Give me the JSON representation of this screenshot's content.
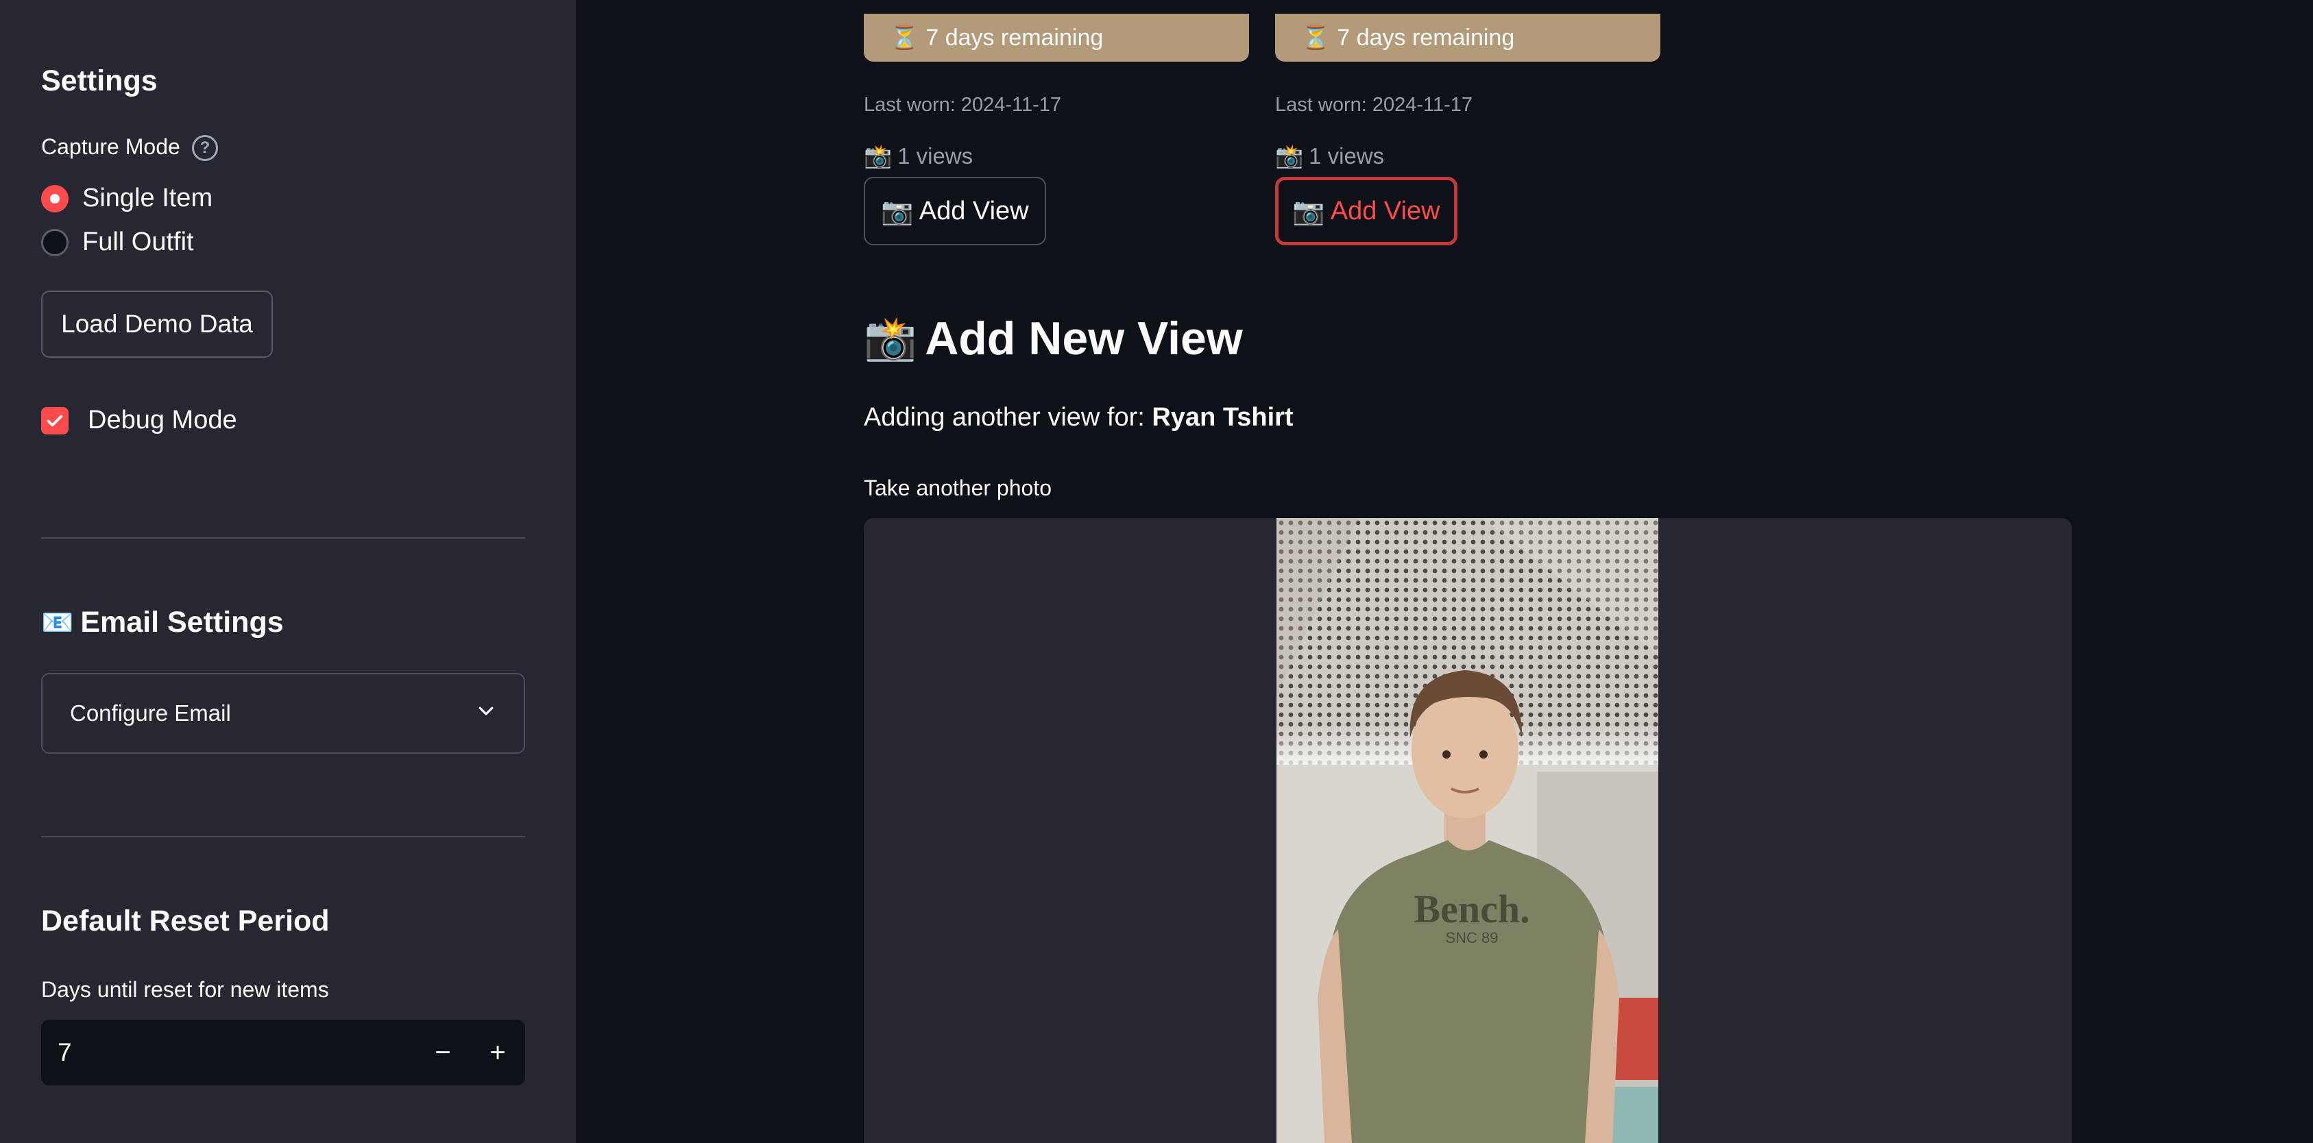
{
  "sidebar": {
    "settings_title": "Settings",
    "capture_mode": {
      "label": "Capture Mode",
      "options": [
        "Single Item",
        "Full Outfit"
      ],
      "selected": "Single Item"
    },
    "load_demo_label": "Load Demo Data",
    "debug_mode": {
      "label": "Debug Mode",
      "checked": true
    },
    "email_settings_title": "Email Settings",
    "email_settings_icon": "📧",
    "configure_email_label": "Configure Email",
    "default_reset_title": "Default Reset Period",
    "days_label": "Days until reset for new items",
    "days_value": "7",
    "minus": "−",
    "plus": "+"
  },
  "items": [
    {
      "status_icon": "⏳",
      "status": "7 days remaining",
      "last_worn": "Last worn: 2024-11-17",
      "views_icon": "📸",
      "views": "1 views",
      "add_view_icon": "📷",
      "add_view_label": "Add View",
      "active": false
    },
    {
      "status_icon": "⏳",
      "status": "7 days remaining",
      "last_worn": "Last worn: 2024-11-17",
      "views_icon": "📸",
      "views": "1 views",
      "add_view_icon": "📷",
      "add_view_label": "Add View",
      "active": true
    }
  ],
  "add_new_view": {
    "title_icon": "📸",
    "title": "Add New View",
    "adding_prefix": "Adding another view for: ",
    "item_name": "Ryan Tshirt",
    "camera_label": "Take another photo",
    "shirt_text_1": "Bench.",
    "shirt_text_2": "SNC 89"
  },
  "colors": {
    "accent": "#ff4b4b",
    "status_bg": "#b39a78",
    "sidebar_bg": "#262730",
    "main_bg": "#0e1117"
  }
}
